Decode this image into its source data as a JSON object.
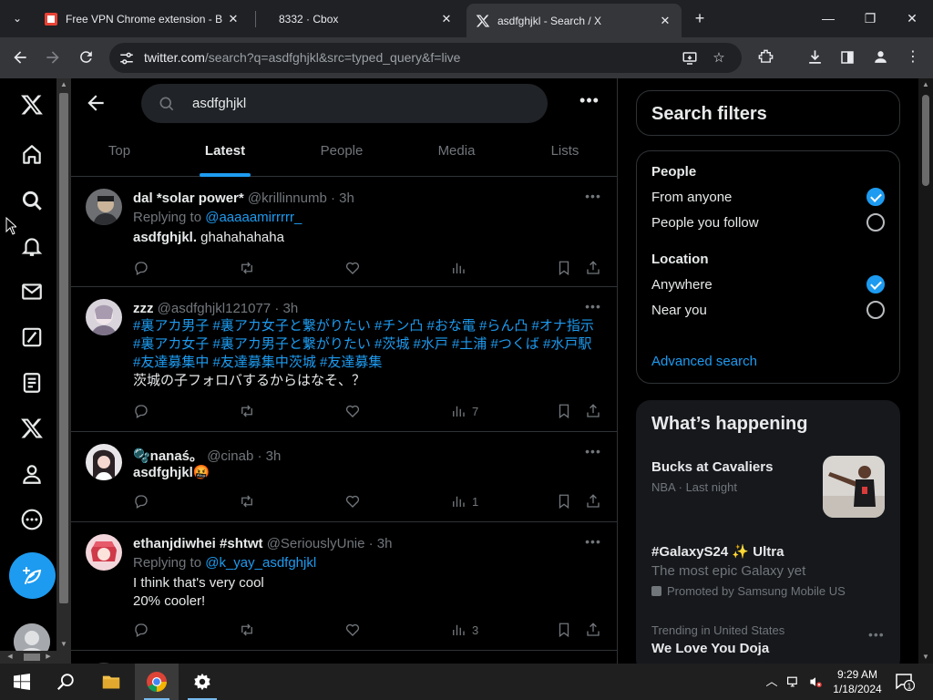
{
  "browser": {
    "tabs": [
      {
        "title": "Free VPN Chrome extension - B",
        "active": false
      },
      {
        "title": "8332 · Cbox",
        "active": false
      },
      {
        "title": "asdfghjkl - Search / X",
        "active": true
      }
    ],
    "url_host": "twitter.com",
    "url_path": "/search?q=asdfghjkl&src=typed_query&f=live"
  },
  "search": {
    "query": "asdfghjkl",
    "tabs": [
      "Top",
      "Latest",
      "People",
      "Media",
      "Lists"
    ],
    "active_tab": "Latest"
  },
  "tweets": [
    {
      "name": "dal *solar power*",
      "handle": "@krillinnumb",
      "time": "· 3h",
      "replying_prefix": "Replying to",
      "replying_to": "@aaaaamirrrrr_",
      "text_bold": "asdfghjkl.",
      "text": " ghahahahaha",
      "views": ""
    },
    {
      "name": "zzz",
      "handle": "@asdfghjkl121077",
      "time": "· 3h",
      "hashtags": "#裏アカ男子 #裏アカ女子と繋がりたい #チン凸 #おな電 #らん凸 #オナ指示 #裏アカ女子 #裏アカ男子と繋がりたい #茨城 #水戸 #土浦 #つくば #水戸駅 #友達募集中 #友達募集中茨城 #友達募集",
      "text": "茨城の子フォロバするからはなそ、？",
      "views": "7"
    },
    {
      "name": "🫧nanaś。",
      "handle": "@cinab",
      "time": "· 3h",
      "text_bold": "asdfghjkl",
      "emoji": "🤬",
      "views": "1"
    },
    {
      "name": "ethanjdiwhei #shtwt",
      "handle": "@SeriouslyUnie",
      "time": "· 3h",
      "replying_prefix": "Replying to",
      "replying_to": "@k_yay_asdfghjkl",
      "line1": "I think that's very cool",
      "line2": "20% cooler!",
      "views": "3"
    }
  ],
  "filters": {
    "title": "Search filters",
    "people_heading": "People",
    "from_anyone": "From anyone",
    "people_you_follow": "People you follow",
    "location_heading": "Location",
    "anywhere": "Anywhere",
    "near_you": "Near you",
    "advanced": "Advanced search"
  },
  "happening": {
    "title": "What’s happening",
    "trends": [
      {
        "title": "Bucks at Cavaliers",
        "sub": "NBA · Last night"
      },
      {
        "title": "#GalaxyS24 ✨ Ultra",
        "desc": "The most epic Galaxy yet",
        "promoted": "Promoted by Samsung Mobile US"
      },
      {
        "context": "Trending in United States",
        "title": "We Love You Doja"
      }
    ]
  },
  "taskbar": {
    "time": "9:29 AM",
    "date": "1/18/2024",
    "notifications": "1"
  },
  "colors": {
    "accent": "#1d9bf0",
    "bg": "#000000",
    "muted": "#71767b",
    "border": "#2f3336"
  }
}
